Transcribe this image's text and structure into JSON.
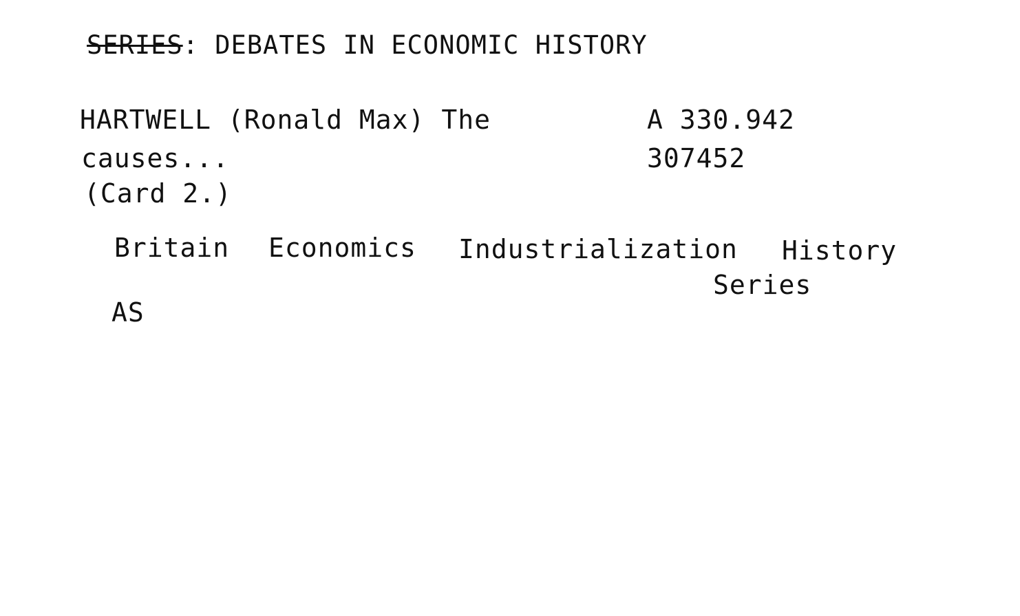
{
  "series": {
    "prefix_struck": "SERIES",
    "separator": ":",
    "title": " DEBATES IN ECONOMIC HISTORY"
  },
  "entry": {
    "author_line": "HARTWELL (Ronald Max) The",
    "title_continuation": "causes...",
    "card_number": "(Card 2.)"
  },
  "call_number": {
    "class": "A 330.942",
    "accession": "307452"
  },
  "subjects": [
    "Britain",
    "Economics",
    "Industrialization",
    "History",
    "Series"
  ],
  "initials": "AS"
}
